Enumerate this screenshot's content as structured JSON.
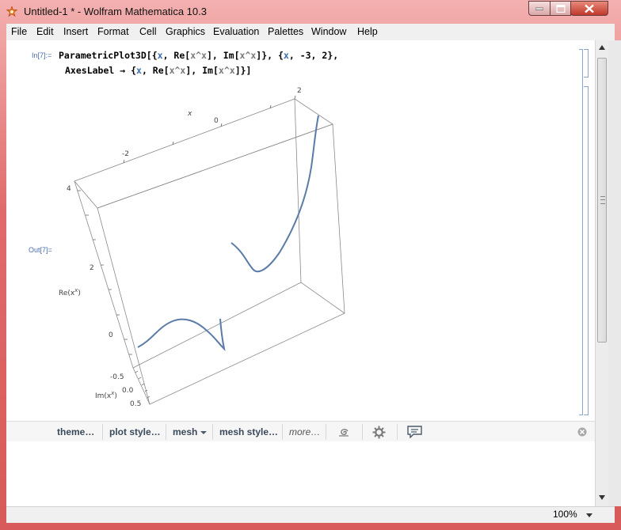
{
  "window": {
    "title": "Untitled-1 * - Wolfram Mathematica 10.3"
  },
  "menu": [
    "File",
    "Edit",
    "Insert",
    "Format",
    "Cell",
    "Graphics",
    "Evaluation",
    "Palettes",
    "Window",
    "Help"
  ],
  "cell": {
    "in_label": "In[7]:=",
    "out_label": "Out[7]=",
    "line1_prefix": "ParametricPlot3D[{",
    "line1_parts": [
      "x",
      ", Re[",
      "x^x",
      "], Im[",
      "x^x",
      "]}, {",
      "x",
      ", -3, 2},"
    ],
    "line2_parts": [
      "AxesLabel",
      " → {",
      "x",
      ", Re[",
      "x^x",
      "], Im[",
      "x^x",
      "]}]"
    ]
  },
  "plot": {
    "x_axis_label": "x",
    "y_axis_label": "Re(x",
    "y_axis_label_sup": "x",
    "y_axis_label_end": ")",
    "z_axis_label": "Im(x",
    "z_axis_label_sup": "x",
    "z_axis_label_end": ")",
    "x_ticks": [
      "-2",
      "0",
      "2"
    ],
    "y_ticks": [
      "4",
      "2",
      "0"
    ],
    "z_ticks": [
      "-0.5",
      "0.0",
      "0.5"
    ],
    "curve_color": "#5b7ba8"
  },
  "toolbar": {
    "theme": "theme…",
    "plot_style": "plot style…",
    "mesh": "mesh",
    "mesh_style": "mesh style…",
    "more": "more…"
  },
  "status": {
    "zoom": "100%"
  }
}
